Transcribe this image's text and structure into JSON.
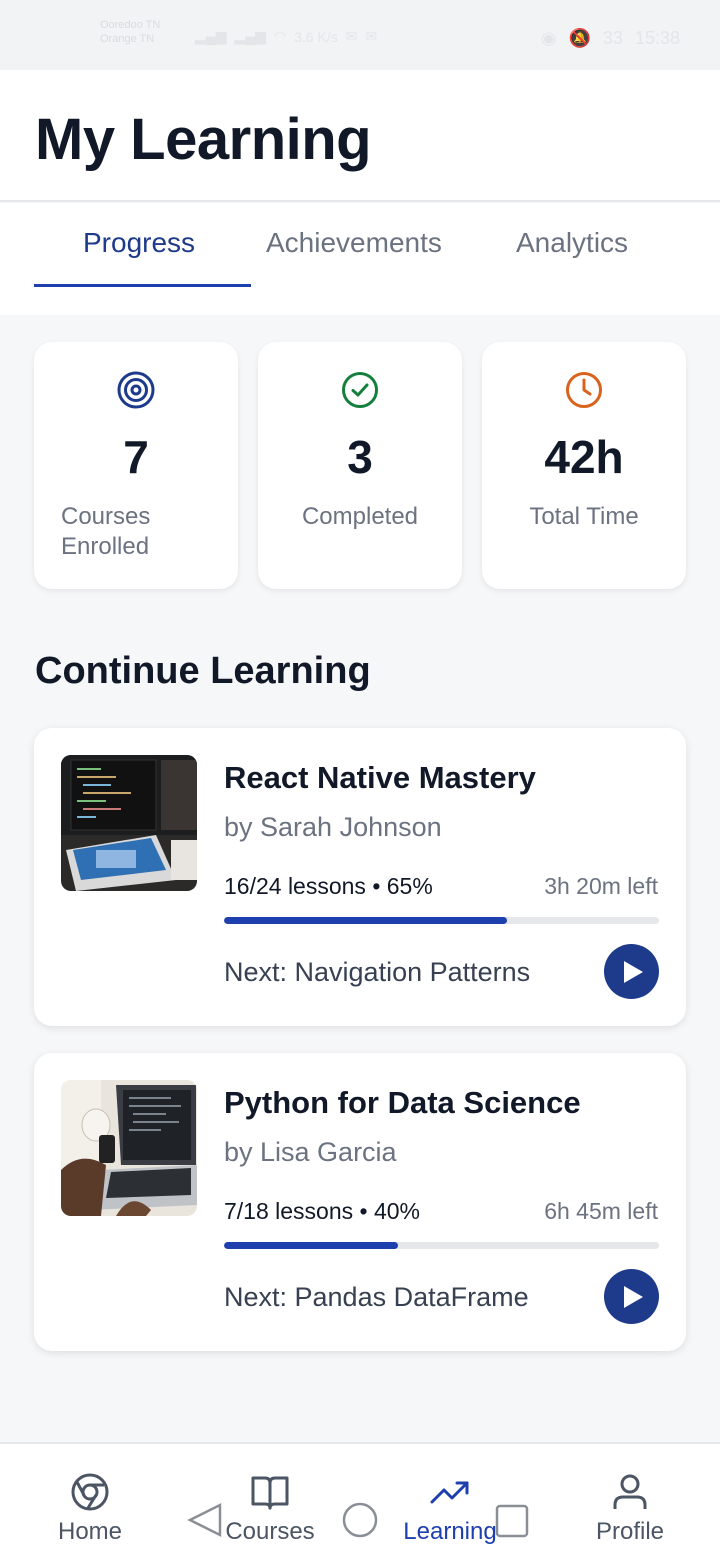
{
  "status_bar": {
    "carrier_line1": "Ooredoo TN",
    "carrier_line2": "Orange TN",
    "net_speed": "3.6 K/s",
    "battery": "33",
    "time": "15:38"
  },
  "header": {
    "title": "My Learning"
  },
  "tabs": [
    {
      "label": "Progress",
      "active": true
    },
    {
      "label": "Achievements",
      "active": false
    },
    {
      "label": "Analytics",
      "active": false
    }
  ],
  "stats": [
    {
      "icon": "target-icon",
      "value": "7",
      "label": "Courses Enrolled",
      "color": "#1e3a8a"
    },
    {
      "icon": "check-circle-icon",
      "value": "3",
      "label": "Completed",
      "color": "#15803d"
    },
    {
      "icon": "clock-icon",
      "value": "42h",
      "label": "Total Time",
      "color": "#d9621c"
    }
  ],
  "section": {
    "title": "Continue Learning"
  },
  "courses": [
    {
      "title": "React Native Mastery",
      "author": "by Sarah Johnson",
      "lessons": "16/24 lessons • 65%",
      "time_left": "3h 20m left",
      "progress": 0.65,
      "next": "Next: Navigation Patterns"
    },
    {
      "title": "Python for Data Science",
      "author": "by Lisa Garcia",
      "lessons": "7/18 lessons • 40%",
      "time_left": "6h 45m left",
      "progress": 0.4,
      "next": "Next: Pandas DataFrame"
    }
  ],
  "bottom_nav": [
    {
      "icon": "home-icon",
      "label": "Home",
      "active": false
    },
    {
      "icon": "book-icon",
      "label": "Courses",
      "active": false
    },
    {
      "icon": "trending-up-icon",
      "label": "Learning",
      "active": true
    },
    {
      "icon": "user-icon",
      "label": "Profile",
      "active": false
    }
  ],
  "colors": {
    "primary": "#1e3a8a",
    "accent": "#1e40af",
    "text": "#111827",
    "muted": "#6b7280"
  }
}
